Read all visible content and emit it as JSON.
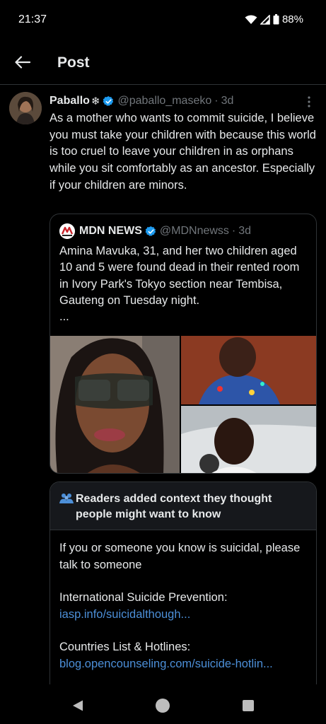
{
  "status": {
    "time": "21:37",
    "battery": "88%"
  },
  "header": {
    "title": "Post"
  },
  "post": {
    "author": "Paballo",
    "author_emoji": "❄",
    "handle": "@paballo_maseko",
    "separator": "·",
    "time": "3d",
    "text": "As a mother who wants to commit suicide, I believe you must take your children with because this world is too cruel to leave your children in as orphans while you sit comfortably as an ancestor. Especially if your children are minors."
  },
  "quote": {
    "author": "MDN NEWS",
    "handle": "@MDNnewss",
    "separator": "·",
    "time": "3d",
    "text": "Amina Mavuka, 31, and her two children aged 10 and 5 were found dead in their rented room in Ivory Park's Tokyo section near Tembisa, Gauteng on Tuesday night.",
    "ellipsis": "..."
  },
  "community_note": {
    "title": "Readers added context they thought people might want to know",
    "line1": "If you or someone you know is suicidal, please talk to someone",
    "line2_prefix": "International Suicide Prevention: ",
    "line2_link": "iasp.info/suicidalthough...",
    "line3_prefix": "Countries List & Hotlines:",
    "line3_link": "blog.opencounseling.com/suicide-hotlin..."
  },
  "colors": {
    "background": "#000000",
    "link": "#4c8fd8",
    "verified": "#1d9bf0",
    "muted": "#71767b"
  }
}
